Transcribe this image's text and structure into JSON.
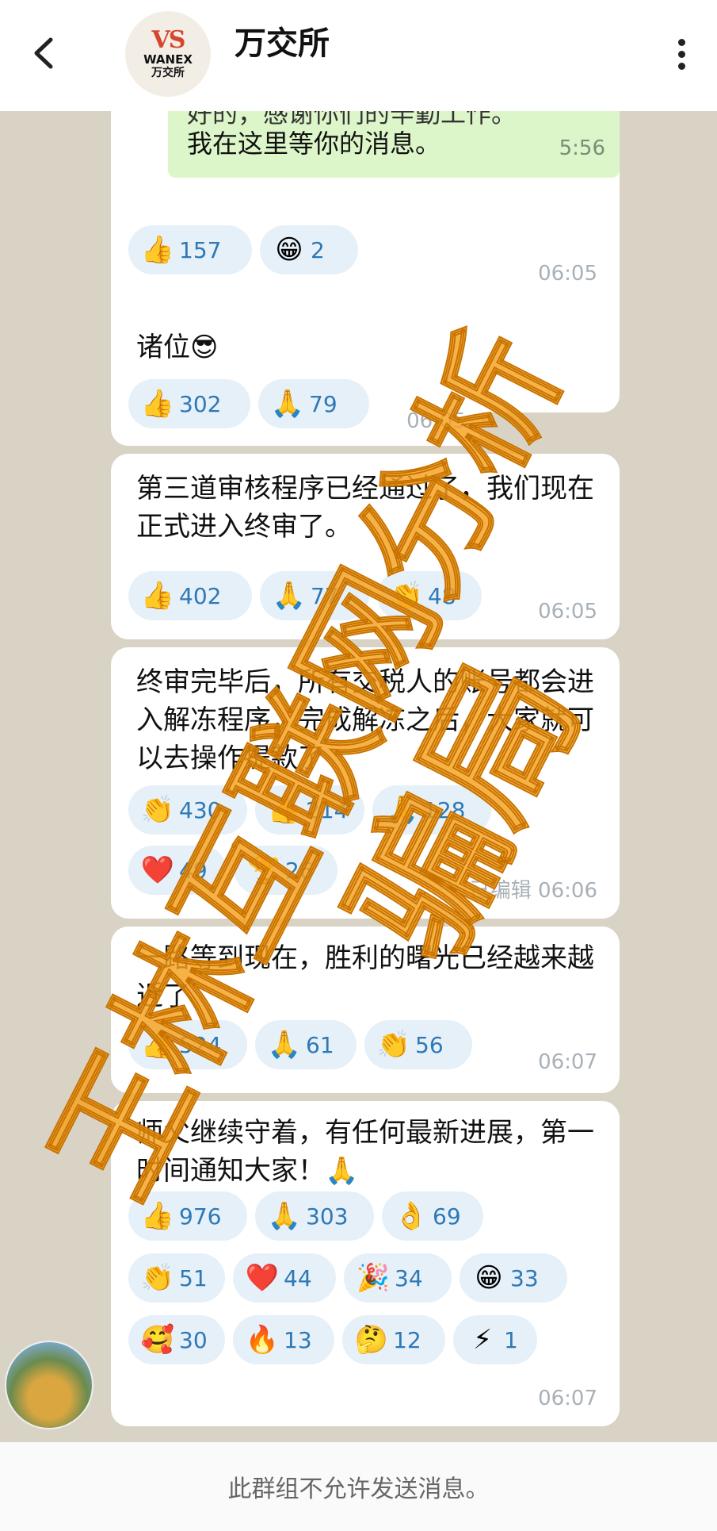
{
  "header": {
    "back_icon": "chevron-left-icon",
    "logo": {
      "vs": "VS",
      "en": "WANEX",
      "cn": "万交所"
    },
    "title": "万交所",
    "menu_icon": "more-vert-icon"
  },
  "messages": [
    {
      "quote_line1": "好的，感谢你们的辛勤工作。",
      "quote_line2": "我在这里等你的消息。",
      "quote_time": "5:56",
      "reactions": [
        {
          "emoji": "👍",
          "count": "157"
        },
        {
          "emoji": "😁",
          "count": "2"
        }
      ],
      "time": "06:05"
    },
    {
      "text": "诸位😎",
      "reactions": [
        {
          "emoji": "👍",
          "count": "302"
        },
        {
          "emoji": "🙏",
          "count": "79"
        }
      ],
      "time": "06:05"
    },
    {
      "text": "第三道审核程序已经通过了，我们现在正式进入终审了。",
      "reactions": [
        {
          "emoji": "👍",
          "count": "402"
        },
        {
          "emoji": "🙏",
          "count": "77"
        },
        {
          "emoji": "👏",
          "count": "48"
        }
      ],
      "time": "06:05"
    },
    {
      "text": "终审完毕后，所有交税人的账号都会进入解冻程序，完成解冻之后，大家就可以去操作提款了",
      "reactions": [
        {
          "emoji": "👏",
          "count": "430"
        },
        {
          "emoji": "👍",
          "count": "214"
        },
        {
          "emoji": "🙏",
          "count": "128"
        },
        {
          "emoji": "❤️",
          "count": "49"
        },
        {
          "emoji": "🏆",
          "count": "26"
        }
      ],
      "time": "已编辑 06:06"
    },
    {
      "text": "一路等到现在，胜利的曙光已经越来越近了",
      "reactions": [
        {
          "emoji": "👍",
          "count": "524"
        },
        {
          "emoji": "🙏",
          "count": "61"
        },
        {
          "emoji": "👏",
          "count": "56"
        }
      ],
      "time": "06:07"
    },
    {
      "text": "师父继续守着，有任何最新进展，第一时间通知大家！🙏",
      "reactions": [
        {
          "emoji": "👍",
          "count": "976"
        },
        {
          "emoji": "🙏",
          "count": "303"
        },
        {
          "emoji": "👌",
          "count": "69"
        },
        {
          "emoji": "👏",
          "count": "51"
        },
        {
          "emoji": "❤️",
          "count": "44"
        },
        {
          "emoji": "🎉",
          "count": "34"
        },
        {
          "emoji": "😁",
          "count": "33"
        },
        {
          "emoji": "🥰",
          "count": "30"
        },
        {
          "emoji": "🔥",
          "count": "13"
        },
        {
          "emoji": "🤔",
          "count": "12"
        },
        {
          "emoji": "⚡",
          "count": "1"
        }
      ],
      "time": "06:07"
    }
  ],
  "footer": {
    "text": "此群组不允许发送消息。"
  },
  "watermark": {
    "line1": "王林互联网分析",
    "line2": "骗局"
  },
  "colors": {
    "bubble": "#ffffff",
    "reaction_bg": "#e6f0f8",
    "reaction_count": "#2e78b6",
    "quote_bg": "#dcf6c9",
    "watermark": "#f5a11e"
  }
}
